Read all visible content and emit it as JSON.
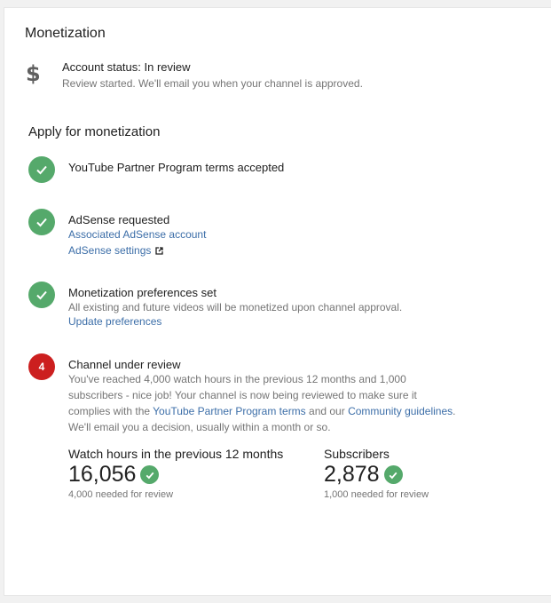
{
  "header": {
    "title": "Monetization"
  },
  "account": {
    "icon": "dollar-icon",
    "status": "Account status: In review",
    "description": "Review started. We'll email you when your channel is approved."
  },
  "apply": {
    "title": "Apply for monetization",
    "steps": [
      {
        "icon": "check-icon",
        "title": "YouTube Partner Program terms accepted"
      },
      {
        "icon": "check-icon",
        "title": "AdSense requested",
        "link1": "Associated AdSense account",
        "link2": "AdSense settings",
        "link2_icon": "external-link-icon"
      },
      {
        "icon": "check-icon",
        "title": "Monetization preferences set",
        "description": "All existing and future videos will be monetized upon channel approval.",
        "link": "Update preferences"
      },
      {
        "number": "4",
        "title": "Channel under review",
        "text1": "You've reached 4,000 watch hours in the previous 12 months and 1,000 subscribers - nice job! Your channel is now being reviewed to make sure it complies with the ",
        "link_terms": "YouTube Partner Program terms",
        "text2": " and our ",
        "link_guidelines": "Community guidelines",
        "text3": ".",
        "text4": "We'll email you a decision, usually within a month or so."
      }
    ]
  },
  "metrics": {
    "watch_hours": {
      "label": "Watch hours in the previous 12 months",
      "value": "16,056",
      "sub": "4,000 needed for review"
    },
    "subscribers": {
      "label": "Subscribers",
      "value": "2,878",
      "sub": "1,000 needed for review"
    }
  },
  "colors": {
    "check_green": "#55a96b",
    "step_red": "#cc1f1f",
    "link_blue": "#3c6ea8"
  }
}
